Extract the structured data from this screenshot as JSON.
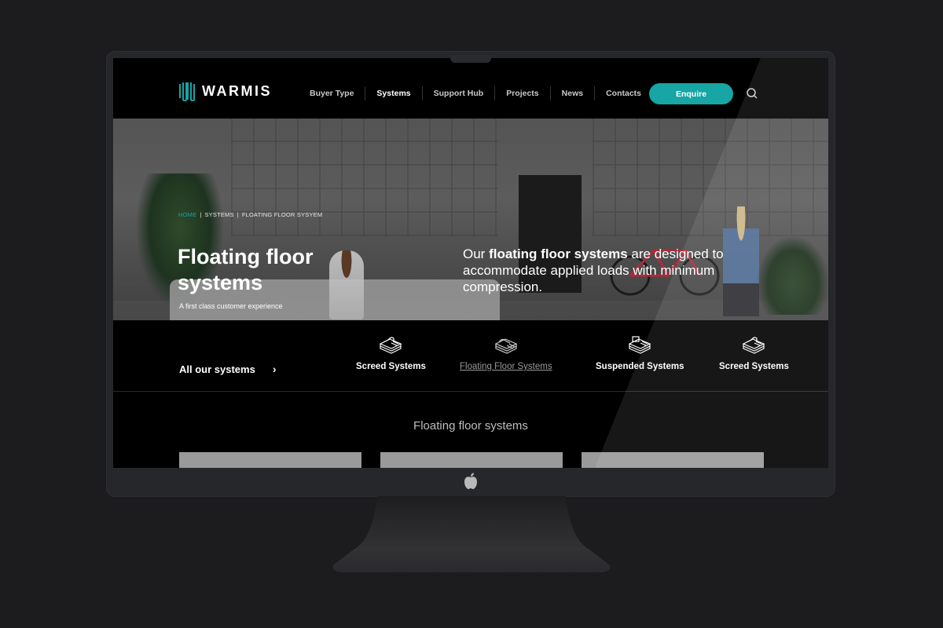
{
  "brand": {
    "name": "WARMIS",
    "accent_color": "#17a5a5"
  },
  "nav": {
    "items": [
      {
        "label": "Buyer Type",
        "active": false
      },
      {
        "label": "Systems",
        "active": true
      },
      {
        "label": "Support Hub",
        "active": false
      },
      {
        "label": "Projects",
        "active": false
      },
      {
        "label": "News",
        "active": false
      },
      {
        "label": "Contacts",
        "active": false
      }
    ],
    "cta_label": "Enquire",
    "search_icon": "search-icon"
  },
  "hero": {
    "breadcrumb": [
      "HOME",
      "SYSTEMS",
      "FLOATING FLOOR SYSYEM"
    ],
    "title": "Floating floor systems",
    "subtitle": "A first class customer experience",
    "description_prefix": "Our ",
    "description_bold": "floating floor systems",
    "description_suffix": " are designed to accommodate applied loads with minimum compression.",
    "icon": "floor-system-icon"
  },
  "systems_bar": {
    "all_label": "All our systems",
    "items": [
      {
        "label": "Screed Systems",
        "current": false
      },
      {
        "label": "Floating Floor Systems",
        "current": true
      },
      {
        "label": "Suspended Systems",
        "current": false
      },
      {
        "label": "Screed Systems",
        "current": false
      }
    ]
  },
  "section": {
    "title": "Floating floor systems",
    "card_count": 3
  }
}
